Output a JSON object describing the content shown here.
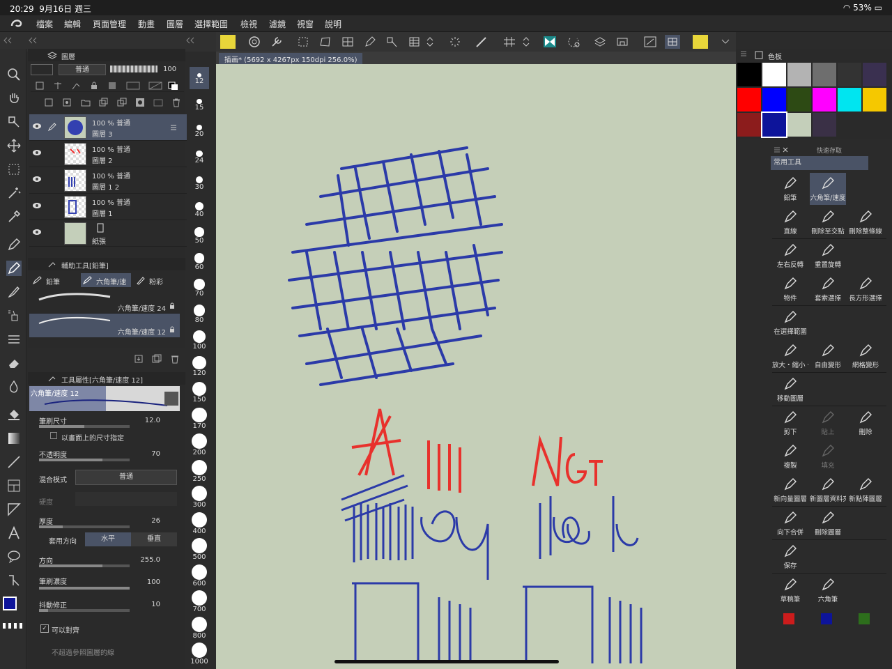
{
  "status": {
    "time": "20:29",
    "date": "9月16日 週三",
    "battery": "53%"
  },
  "menu": [
    "檔案",
    "編輯",
    "頁面管理",
    "動畫",
    "圖層",
    "選擇範圍",
    "檢視",
    "濾鏡",
    "視窗",
    "說明"
  ],
  "document": {
    "tab": "插画* (5692 x 4267px 150dpi 256.0%)"
  },
  "layer_panel": {
    "title": "圖層",
    "blend_mode": "普通",
    "opacity_value": "100",
    "layers": [
      {
        "info": "100 % 普通",
        "name": "圖層 3",
        "selected": true
      },
      {
        "info": "100 % 普通",
        "name": "圖層 2",
        "selected": false
      },
      {
        "info": "100 % 普通",
        "name": "圖層 1 2",
        "selected": false
      },
      {
        "info": "100 % 普通",
        "name": "圖層 1",
        "selected": false
      },
      {
        "info": "",
        "name": "紙張",
        "selected": false
      }
    ]
  },
  "sub_tool": {
    "title": "輔助工具[鉛筆]",
    "tabs": [
      "鉛筆",
      "六角筆/速",
      "粉彩"
    ],
    "brushes": [
      "六角筆/速度 24",
      "六角筆/速度 12"
    ]
  },
  "tool_property": {
    "title": "工具屬性[六角筆/速度 12]",
    "preview_label": "六角筆/速度 12",
    "brush_size_label": "筆刷尺寸",
    "brush_size_value": "12.0",
    "screen_size_label": "以畫面上的尺寸指定",
    "opacity_label": "不透明度",
    "opacity_value": "70",
    "blend_label": "混合模式",
    "blend_value": "普通",
    "hardness_label": "硬度",
    "thickness_label": "厚度",
    "thickness_value": "26",
    "apply_dir_label": "套用方向",
    "horizontal": "水平",
    "vertical": "垂直",
    "direction_label": "方向",
    "direction_value": "255.0",
    "density_label": "筆刷濃度",
    "density_value": "100",
    "stabilization_label": "抖動修正",
    "stabilization_value": "10",
    "snap_label": "可以對齊",
    "ref_label": "不超過參照圖層的線"
  },
  "brush_sizes": [
    "12",
    "15",
    "20",
    "24",
    "30",
    "40",
    "50",
    "60",
    "70",
    "80",
    "100",
    "120",
    "150",
    "170",
    "200",
    "250",
    "300",
    "400",
    "500",
    "600",
    "700",
    "800",
    "1000"
  ],
  "palette": {
    "title": "色板",
    "colors": [
      "#000000",
      "#ffffff",
      "#b3b3b3",
      "#6e6e6e",
      "#333333",
      "#3a3050",
      "#ff0000",
      "#0000ff",
      "#2d4a14",
      "#ff00ff",
      "#00e5f0",
      "#f5c800",
      "#8c1c1c",
      "#0d149a",
      "#c4cfba",
      "#3a3046",
      "#2a2a2a",
      "#2a2a2a"
    ]
  },
  "quick_access": {
    "title": "快速存取",
    "set_name": "常用工具",
    "items": [
      "鉛筆",
      "六角筆/速度",
      "直線",
      "刪除至交點",
      "刪除整條線",
      "左右反轉",
      "重置旋轉",
      "物件",
      "套索選擇",
      "長方形選擇",
      "在選擇範圍",
      "放大・縮小・",
      "自由變形",
      "網格變形",
      "移動圖層",
      "剪下",
      "貼上",
      "刪除",
      "複製",
      "填充",
      "新向量圖層",
      "新圖層資料夾",
      "新點陣圖層",
      "向下合併",
      "刪除圖層",
      "保存",
      "草稿筆",
      "六角筆"
    ],
    "bottom_colors": [
      "#cc1c1c",
      "#0d149a",
      "#2d6e1c"
    ]
  }
}
